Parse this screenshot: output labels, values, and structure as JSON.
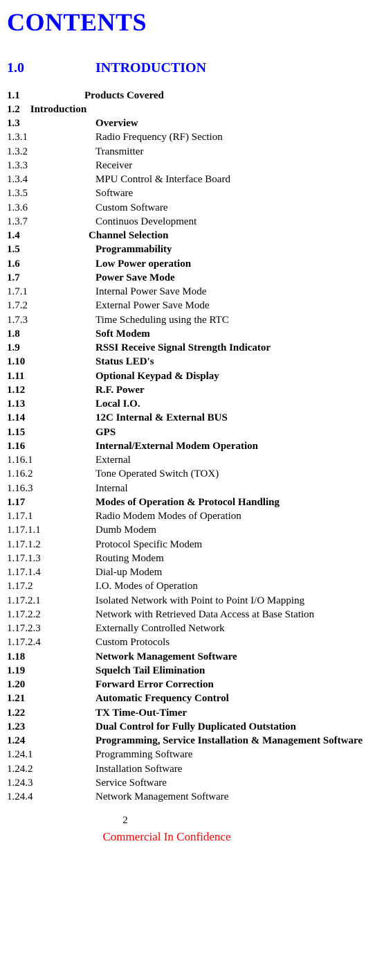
{
  "title": "CONTENTS",
  "section": {
    "num": "1.0",
    "label": "INTRODUCTION"
  },
  "entries": [
    {
      "num": "1.1",
      "label": "Products Covered",
      "bold": true,
      "numClass": "num-short"
    },
    {
      "num": "1.2    Introduction",
      "label": "",
      "bold": true,
      "single": true
    },
    {
      "num": "1.3",
      "label": "Overview",
      "bold": true
    },
    {
      "num": "1.3.1",
      "label": "Radio Frequency (RF) Section"
    },
    {
      "num": "1.3.2",
      "label": "Transmitter"
    },
    {
      "num": "1.3.3",
      "label": "Receiver"
    },
    {
      "num": "1.3.4",
      "label": "MPU Control & Interface Board"
    },
    {
      "num": "1.3.5",
      "label": "Software"
    },
    {
      "num": "1.3.6",
      "label": "Custom Software"
    },
    {
      "num": "1.3.7",
      "label": "Continuos Development"
    },
    {
      "num": "1.4",
      "label": "Channel Selection",
      "bold": true,
      "numClass": "num-shortish"
    },
    {
      "num": "1.5",
      "label": "Programmability",
      "bold": true
    },
    {
      "num": "1.6",
      "label": "Low Power operation",
      "bold": true
    },
    {
      "num": "1.7",
      "label": "Power Save Mode",
      "bold": true
    },
    {
      "num": "1.7.1",
      "label": "Internal Power Save Mode"
    },
    {
      "num": "1.7.2",
      "label": "External Power Save Mode"
    },
    {
      "num": "1.7.3",
      "label": "Time Scheduling using the RTC"
    },
    {
      "num": "1.8",
      "label": "Soft Modem",
      "bold": true
    },
    {
      "num": "1.9",
      "label": "RSSI Receive Signal Strength Indicator",
      "bold": true
    },
    {
      "num": "1.10",
      "label": "Status LED's",
      "bold": true
    },
    {
      "num": "1.11",
      "label": "Optional Keypad & Display",
      "bold": true
    },
    {
      "num": "1.12",
      "label": "R.F. Power",
      "bold": true
    },
    {
      "num": "1.13",
      "label": "Local I.O.",
      "bold": true
    },
    {
      "num": "1.14",
      "label": "12C Internal & External BUS",
      "bold": true
    },
    {
      "num": "1.15",
      "label": "GPS",
      "bold": true
    },
    {
      "num": "1.16",
      "label": "Internal/External Modem Operation",
      "bold": true
    },
    {
      "num": "1.16.1",
      "label": "External"
    },
    {
      "num": "1.16.2",
      "label": "Tone Operated Switch (TOX)"
    },
    {
      "num": "1.16.3",
      "label": "Internal"
    },
    {
      "num": "1.17",
      "label": "Modes of Operation & Protocol Handling",
      "bold": true
    },
    {
      "num": "1.17.1",
      "label": "Radio Modem Modes of Operation"
    },
    {
      "num": "1.17.1.1",
      "label": "Dumb Modem"
    },
    {
      "num": "1.17.1.2",
      "label": "Protocol Specific Modem"
    },
    {
      "num": "1.17.1.3",
      "label": "Routing Modem"
    },
    {
      "num": "1.17.1.4",
      "label": "Dial-up Modem"
    },
    {
      "num": "1.17.2",
      "label": "I.O. Modes of Operation"
    },
    {
      "num": "1.17.2.1",
      "label": "Isolated Network with Point to Point I/O Mapping"
    },
    {
      "num": "1.17.2.2",
      "label": "Network with Retrieved Data Access at Base Station"
    },
    {
      "num": "1.17.2.3",
      "label": "Externally Controlled Network"
    },
    {
      "num": "1.17.2.4",
      "label": "Custom Protocols"
    },
    {
      "num": "1.18",
      "label": "Network Management Software",
      "bold": true
    },
    {
      "num": "1.19",
      "label": "Squelch Tail Elimination",
      "bold": true
    },
    {
      "num": "1.20",
      "label": "Forward Error Correction",
      "bold": true
    },
    {
      "num": "1.21",
      "label": "Automatic Frequency Control",
      "bold": true
    },
    {
      "num": "1.22",
      "label": "TX Time-Out-Timer",
      "bold": true
    },
    {
      "num": "1.23",
      "label": "Dual Control for Fully Duplicated Outstation",
      "bold": true
    },
    {
      "num": "1.24",
      "label": "Programming, Service Installation & Management Software",
      "bold": true
    },
    {
      "num": "1.24.1",
      "label": "Programming Software"
    },
    {
      "num": "1.24.2",
      "label": "Installation Software"
    },
    {
      "num": "1.24.3",
      "label": "Service Software"
    },
    {
      "num": "1.24.4",
      "label": "Network Management Software"
    }
  ],
  "footer": {
    "page": "2",
    "confidential": "Commercial In Confidence"
  }
}
